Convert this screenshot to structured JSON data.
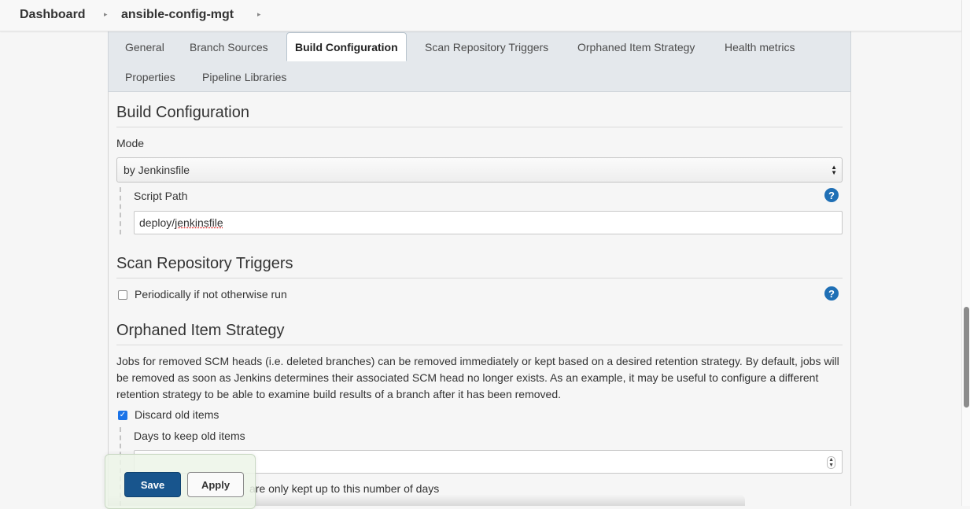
{
  "breadcrumb": {
    "items": [
      "Dashboard",
      "ansible-config-mgt"
    ],
    "separator": "›"
  },
  "tabs": [
    {
      "label": "General",
      "active": false
    },
    {
      "label": "Branch Sources",
      "active": false
    },
    {
      "label": "Build Configuration",
      "active": true
    },
    {
      "label": "Scan Repository Triggers",
      "active": false
    },
    {
      "label": "Orphaned Item Strategy",
      "active": false
    },
    {
      "label": "Health metrics",
      "active": false
    },
    {
      "label": "Properties",
      "active": false
    },
    {
      "label": "Pipeline Libraries",
      "active": false
    }
  ],
  "build_config": {
    "title": "Build Configuration",
    "mode_label": "Mode",
    "mode_value": "by Jenkinsfile",
    "script_path_label": "Script Path",
    "script_path_prefix": "deploy/",
    "script_path_word": "jenkinsfile"
  },
  "scan_triggers": {
    "title": "Scan Repository Triggers",
    "periodic_label": "Periodically if not otherwise run",
    "periodic_checked": false
  },
  "orphaned": {
    "title": "Orphaned Item Strategy",
    "description": "Jobs for removed SCM heads (i.e. deleted branches) can be removed immediately or kept based on a desired retention strategy. By default, jobs will be removed as soon as Jenkins determines their associated SCM head no longer exists. As an example, it may be useful to configure a different retention strategy to be able to examine build results of a branch after it has been removed.",
    "discard_label": "Discard old items",
    "discard_checked": true,
    "days_label": "Days to keep old items",
    "days_value": "",
    "days_help_visible": "are only kept up to this number of days"
  },
  "actions": {
    "save_label": "Save",
    "apply_label": "Apply"
  },
  "help_glyph": "?",
  "colors": {
    "primary_button": "#18558d",
    "help_icon": "#1f6fb5",
    "tab_bar": "#e4e8ec",
    "checkbox_checked": "#1a73e8"
  }
}
